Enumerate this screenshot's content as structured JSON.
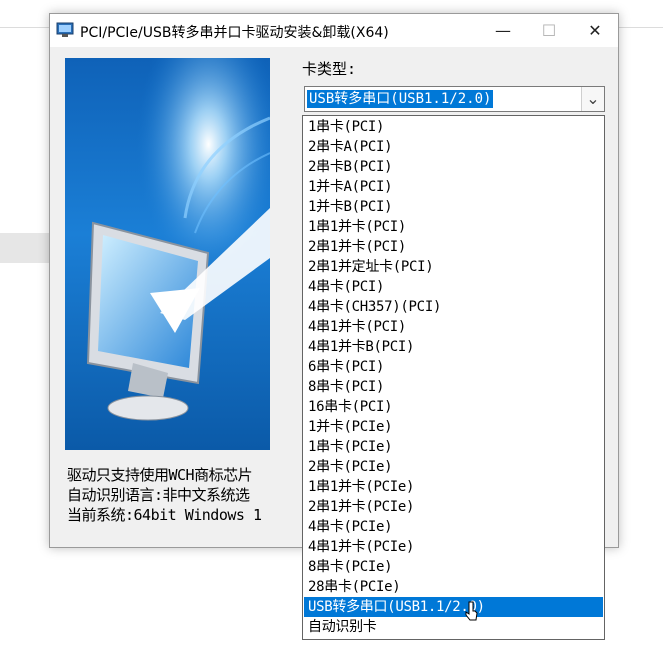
{
  "window": {
    "title": "PCI/PCIe/USB转多串并口卡驱动安装&卸载(X64)",
    "controls": {
      "minimize": "—",
      "maximize": "☐",
      "close": "✕"
    }
  },
  "form": {
    "card_type_label": "卡类型:",
    "selected_value": "USB转多串口(USB1.1/2.0)",
    "arrow": "⌄"
  },
  "info": {
    "line1": "驱动只支持使用WCH商标芯片",
    "line2": "自动识别语言:非中文系统选",
    "line3": "当前系统:64bit Windows 1"
  },
  "dropdown": {
    "options": [
      "1串卡(PCI)",
      "2串卡A(PCI)",
      "2串卡B(PCI)",
      "1并卡A(PCI)",
      "1并卡B(PCI)",
      "1串1并卡(PCI)",
      "2串1并卡(PCI)",
      "2串1并定址卡(PCI)",
      "4串卡(PCI)",
      "4串卡(CH357)(PCI)",
      "4串1并卡(PCI)",
      "4串1并卡B(PCI)",
      "6串卡(PCI)",
      "8串卡(PCI)",
      "16串卡(PCI)",
      "1并卡(PCIe)",
      "1串卡(PCIe)",
      "2串卡(PCIe)",
      "1串1并卡(PCIe)",
      "2串1并卡(PCIe)",
      "4串卡(PCIe)",
      "4串1并卡(PCIe)",
      "8串卡(PCIe)",
      "28串卡(PCIe)",
      "USB转多串口(USB1.1/2.0)",
      "自动识别卡"
    ],
    "selected_index": 24
  },
  "colors": {
    "selection": "#0078d7",
    "banner": "#1b7fd6"
  }
}
